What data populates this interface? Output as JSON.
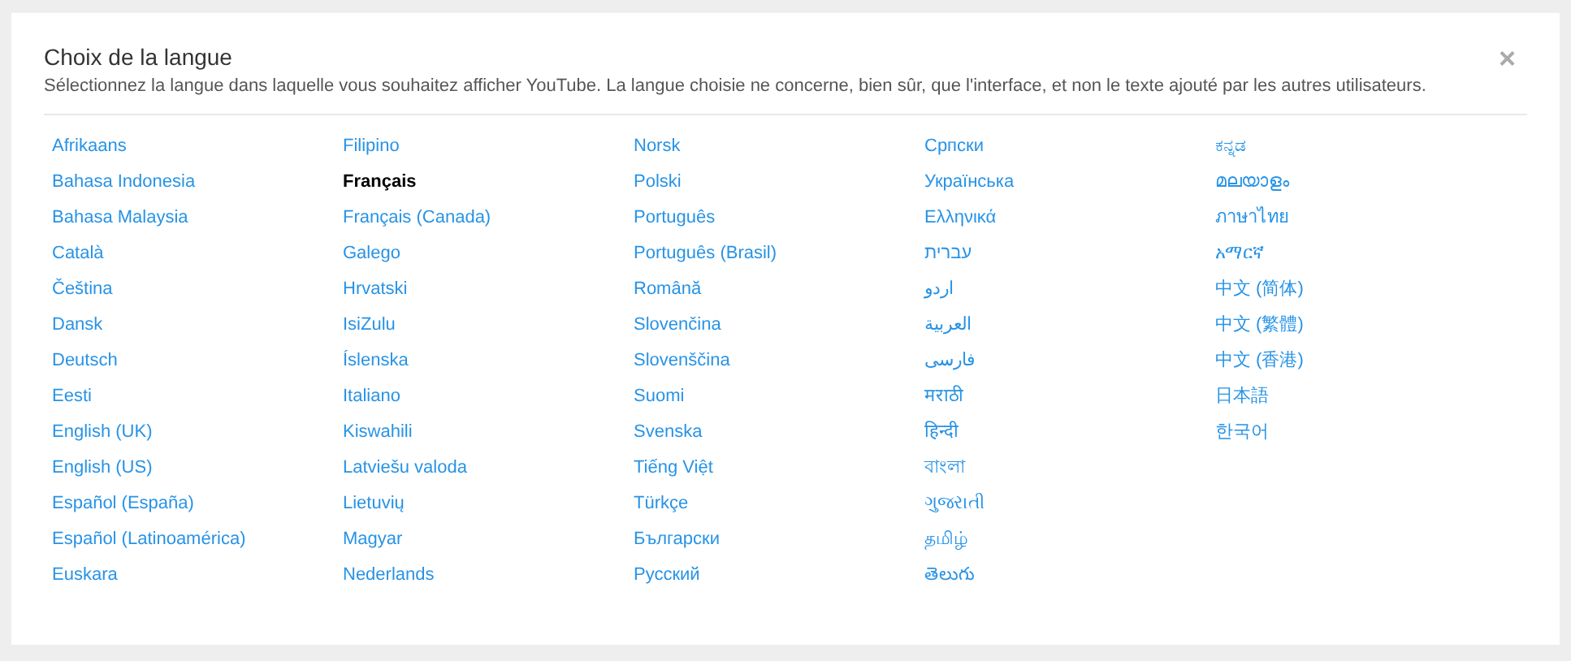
{
  "dialog": {
    "title": "Choix de la langue",
    "description": "Sélectionnez la langue dans laquelle vous souhaitez afficher YouTube. La langue choisie ne concerne, bien sûr, que l'interface, et non le texte ajouté par les autres utilisateurs.",
    "close": "×"
  },
  "columns": [
    [
      {
        "label": "Afrikaans",
        "selected": false
      },
      {
        "label": "Bahasa Indonesia",
        "selected": false
      },
      {
        "label": "Bahasa Malaysia",
        "selected": false
      },
      {
        "label": "Català",
        "selected": false
      },
      {
        "label": "Čeština",
        "selected": false
      },
      {
        "label": "Dansk",
        "selected": false
      },
      {
        "label": "Deutsch",
        "selected": false
      },
      {
        "label": "Eesti",
        "selected": false
      },
      {
        "label": "English (UK)",
        "selected": false
      },
      {
        "label": "English (US)",
        "selected": false
      },
      {
        "label": "Español (España)",
        "selected": false
      },
      {
        "label": "Español (Latinoamérica)",
        "selected": false
      },
      {
        "label": "Euskara",
        "selected": false
      }
    ],
    [
      {
        "label": "Filipino",
        "selected": false
      },
      {
        "label": "Français",
        "selected": true
      },
      {
        "label": "Français (Canada)",
        "selected": false
      },
      {
        "label": "Galego",
        "selected": false
      },
      {
        "label": "Hrvatski",
        "selected": false
      },
      {
        "label": "IsiZulu",
        "selected": false
      },
      {
        "label": "Íslenska",
        "selected": false
      },
      {
        "label": "Italiano",
        "selected": false
      },
      {
        "label": "Kiswahili",
        "selected": false
      },
      {
        "label": "Latviešu valoda",
        "selected": false
      },
      {
        "label": "Lietuvių",
        "selected": false
      },
      {
        "label": "Magyar",
        "selected": false
      },
      {
        "label": "Nederlands",
        "selected": false
      }
    ],
    [
      {
        "label": "Norsk",
        "selected": false
      },
      {
        "label": "Polski",
        "selected": false
      },
      {
        "label": "Português",
        "selected": false
      },
      {
        "label": "Português (Brasil)",
        "selected": false
      },
      {
        "label": "Română",
        "selected": false
      },
      {
        "label": "Slovenčina",
        "selected": false
      },
      {
        "label": "Slovenščina",
        "selected": false
      },
      {
        "label": "Suomi",
        "selected": false
      },
      {
        "label": "Svenska",
        "selected": false
      },
      {
        "label": "Tiếng Việt",
        "selected": false
      },
      {
        "label": "Türkçe",
        "selected": false
      },
      {
        "label": "Български",
        "selected": false
      },
      {
        "label": "Русский",
        "selected": false
      }
    ],
    [
      {
        "label": "Српски",
        "selected": false
      },
      {
        "label": "Українська",
        "selected": false
      },
      {
        "label": "Ελληνικά",
        "selected": false
      },
      {
        "label": "עברית",
        "selected": false
      },
      {
        "label": "اردو",
        "selected": false
      },
      {
        "label": "العربية",
        "selected": false
      },
      {
        "label": "فارسی",
        "selected": false
      },
      {
        "label": "मराठी",
        "selected": false
      },
      {
        "label": "हिन्दी",
        "selected": false
      },
      {
        "label": "বাংলা",
        "selected": false
      },
      {
        "label": "ગુજરાતી",
        "selected": false
      },
      {
        "label": "தமிழ்",
        "selected": false
      },
      {
        "label": "తెలుగు",
        "selected": false
      }
    ],
    [
      {
        "label": "ಕನ್ನಡ",
        "selected": false
      },
      {
        "label": "മലയാളം",
        "selected": false
      },
      {
        "label": "ภาษาไทย",
        "selected": false
      },
      {
        "label": "አማርኛ",
        "selected": false
      },
      {
        "label": "中文 (简体)",
        "selected": false
      },
      {
        "label": "中文 (繁體)",
        "selected": false
      },
      {
        "label": "中文 (香港)",
        "selected": false
      },
      {
        "label": "日本語",
        "selected": false
      },
      {
        "label": "한국어",
        "selected": false
      }
    ]
  ]
}
